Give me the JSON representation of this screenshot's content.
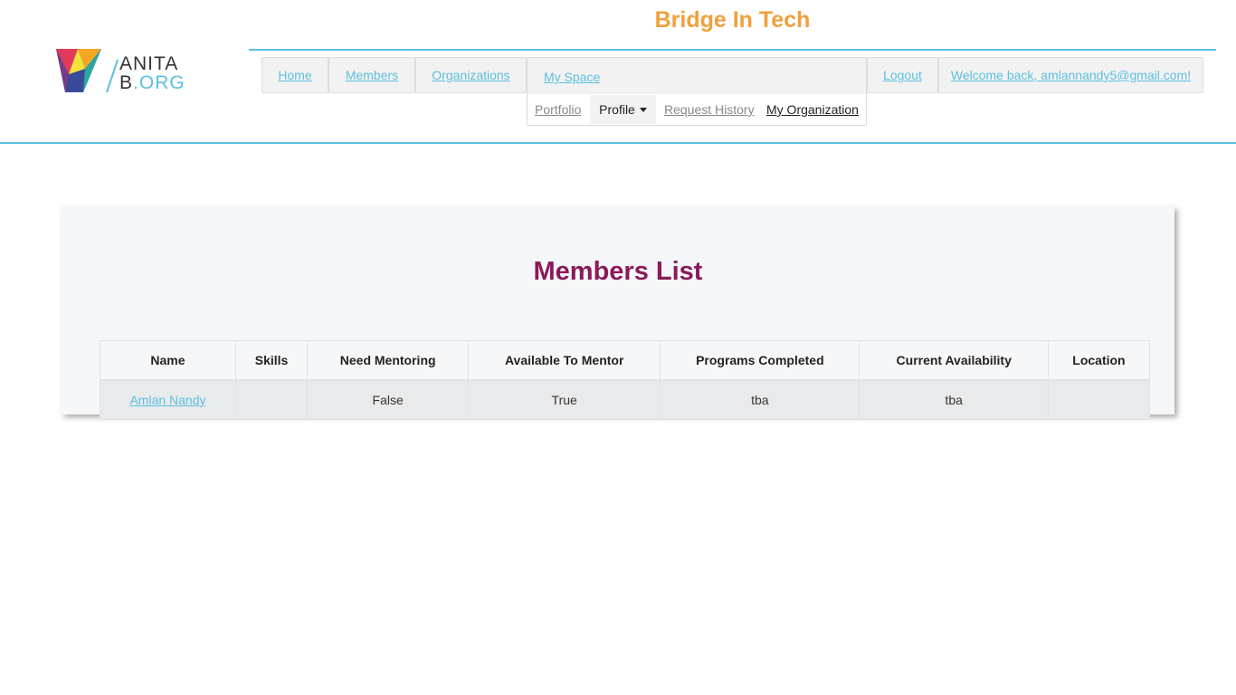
{
  "site": {
    "title": "Bridge In Tech",
    "logo": {
      "line1": "ANITA",
      "line2_b": "B",
      "line2_dot": ".",
      "line2_org": "ORG"
    }
  },
  "colors": {
    "accent": "#5bc0de",
    "title_orange": "#f0a03c",
    "heading_magenta": "#8b1a5b"
  },
  "nav": {
    "home": "Home",
    "members": "Members",
    "organizations": "Organizations",
    "my_space": "My Space",
    "logout": "Logout",
    "welcome": "Welcome back, amlannandy5@gmail.com!",
    "subnav": {
      "portfolio": "Portfolio",
      "profile": "Profile",
      "request_history": "Request History",
      "my_organization": "My Organization"
    }
  },
  "main": {
    "heading": "Members List",
    "table": {
      "columns": [
        "Name",
        "Skills",
        "Need Mentoring",
        "Available To Mentor",
        "Programs Completed",
        "Current Availability",
        "Location"
      ],
      "rows": [
        {
          "name": "Amlan Nandy",
          "skills": "",
          "need_mentoring": "False",
          "available_to_mentor": "True",
          "programs_completed": "tba",
          "current_availability": "tba",
          "location": ""
        }
      ]
    }
  }
}
